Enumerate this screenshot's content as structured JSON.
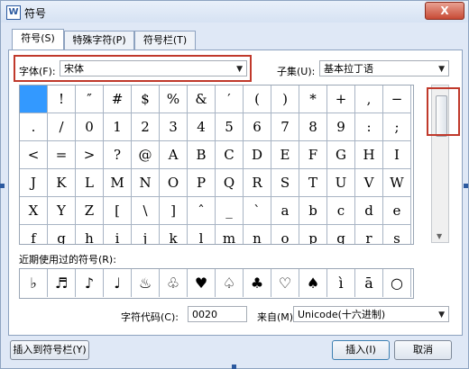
{
  "window": {
    "title": "符号",
    "close_label": "X"
  },
  "tabs": [
    {
      "label": "符号(S)"
    },
    {
      "label": "特殊字符(P)"
    },
    {
      "label": "符号栏(T)"
    }
  ],
  "font": {
    "label": "字体(F):",
    "value": "宋体"
  },
  "subset": {
    "label": "子集(U):",
    "value": "基本拉丁语"
  },
  "grid_rows": [
    [
      " ",
      "!",
      "″",
      "#",
      "$",
      "%",
      "&",
      "′",
      "(",
      ")",
      "*",
      "+",
      ",",
      "−"
    ],
    [
      ".",
      "/",
      "0",
      "1",
      "2",
      "3",
      "4",
      "5",
      "6",
      "7",
      "8",
      "9",
      ":",
      ";"
    ],
    [
      "<",
      "=",
      ">",
      "?",
      "@",
      "A",
      "B",
      "C",
      "D",
      "E",
      "F",
      "G",
      "H",
      "I"
    ],
    [
      "J",
      "K",
      "L",
      "M",
      "N",
      "O",
      "P",
      "Q",
      "R",
      "S",
      "T",
      "U",
      "V",
      "W"
    ],
    [
      "X",
      "Y",
      "Z",
      "[",
      "\\",
      "]",
      "ˆ",
      "_",
      "`",
      "a",
      "b",
      "c",
      "d",
      "e"
    ],
    [
      "f",
      "g",
      "h",
      "i",
      "j",
      "k",
      "l",
      "m",
      "n",
      "o",
      "p",
      "q",
      "r",
      "s"
    ]
  ],
  "recent": {
    "label": "近期使用过的符号(R):",
    "symbols": [
      "♭",
      "♬",
      "♪",
      "♩",
      "♨",
      "♧",
      "♥",
      "♤",
      "♣",
      "♡",
      "♠",
      "ì",
      "ā",
      "○"
    ]
  },
  "char_code": {
    "label": "字符代码(C):",
    "value": "0020"
  },
  "from": {
    "label": "来自(M)",
    "value": "Unicode(十六进制)"
  },
  "buttons": {
    "insert_to_bar": "插入到符号栏(Y)",
    "insert": "插入(I)",
    "cancel": "取消"
  }
}
